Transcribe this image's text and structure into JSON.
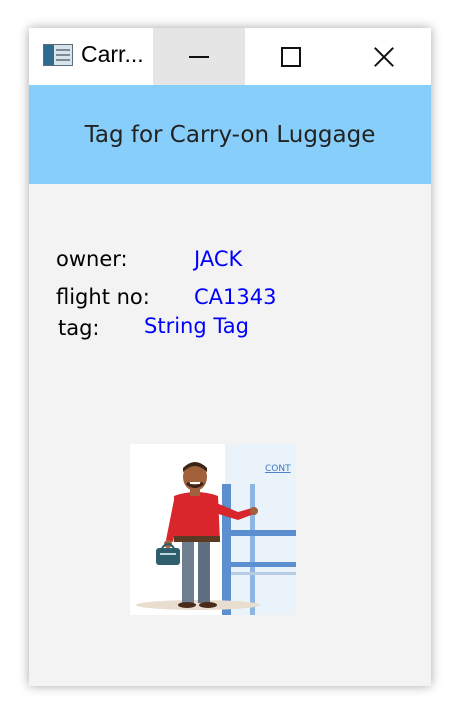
{
  "window": {
    "title": "Carr...",
    "icon": "app-window-icon"
  },
  "controls": {
    "minimize_icon": "minimize-icon",
    "maximize_icon": "maximize-icon",
    "close_icon": "close-icon"
  },
  "banner": {
    "text": "Tag for Carry-on Luggage",
    "background": "#87cefa"
  },
  "fields": {
    "owner_label": "owner:",
    "owner_value": "JACK",
    "flight_label": "flight no:",
    "flight_value": "CA1343",
    "tag_label": "tag:",
    "tag_value": "String Tag",
    "value_color": "#0000ff"
  },
  "illustration": {
    "sign_text": "CONT"
  }
}
